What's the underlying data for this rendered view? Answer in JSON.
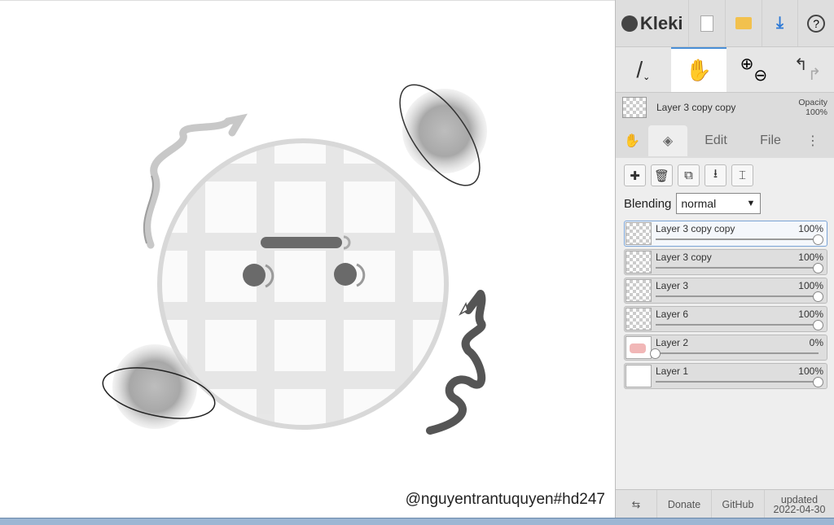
{
  "app": {
    "name": "Kleki"
  },
  "topbar": {
    "new_icon": "new-file-icon",
    "open_icon": "folder-icon",
    "save_icon": "download-icon",
    "help_icon": "help-icon"
  },
  "current_layer": {
    "name": "Layer 3 copy copy",
    "opacity_label": "Opacity",
    "opacity_value": "100%"
  },
  "tabs": {
    "edit": "Edit",
    "file": "File"
  },
  "blending": {
    "label": "Blending",
    "value": "normal"
  },
  "layers": [
    {
      "name": "Layer 3 copy copy",
      "opacity": "100%",
      "level": 1.0,
      "active": true,
      "thumb": "checker"
    },
    {
      "name": "Layer 3 copy",
      "opacity": "100%",
      "level": 1.0,
      "active": false,
      "thumb": "checker"
    },
    {
      "name": "Layer 3",
      "opacity": "100%",
      "level": 1.0,
      "active": false,
      "thumb": "checker"
    },
    {
      "name": "Layer 6",
      "opacity": "100%",
      "level": 1.0,
      "active": false,
      "thumb": "checker"
    },
    {
      "name": "Layer 2",
      "opacity": "0%",
      "level": 0.0,
      "active": false,
      "thumb": "pink"
    },
    {
      "name": "Layer 1",
      "opacity": "100%",
      "level": 1.0,
      "active": false,
      "thumb": "plain"
    }
  ],
  "footer": {
    "donate": "Donate",
    "github": "GitHub",
    "updated_label": "updated",
    "updated_date": "2022-04-30"
  },
  "canvas": {
    "watermark": "@nguyentrantuquyen#hd247"
  }
}
